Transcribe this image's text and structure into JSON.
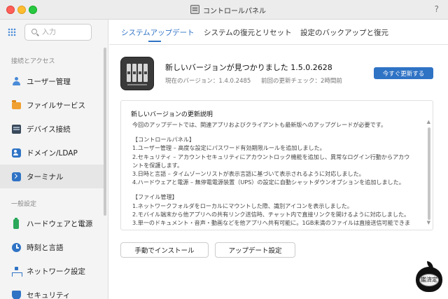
{
  "window": {
    "title": "コントロールパネル",
    "help_label": "?"
  },
  "sidebar": {
    "search_placeholder": "入力",
    "sections": [
      {
        "label": "接続とアクセス",
        "items": [
          {
            "label": "ユーザー管理",
            "icon": "user-icon"
          },
          {
            "label": "ファイルサービス",
            "icon": "folder-icon"
          },
          {
            "label": "デバイス接続",
            "icon": "device-icon"
          },
          {
            "label": "ドメイン/LDAP",
            "icon": "domain-icon"
          },
          {
            "label": "ターミナル",
            "icon": "terminal-icon",
            "active": true
          }
        ]
      },
      {
        "label": "一般設定",
        "items": [
          {
            "label": "ハードウェアと電源",
            "icon": "battery-icon"
          },
          {
            "label": "時刻と言語",
            "icon": "clock-icon"
          },
          {
            "label": "ネットワーク設定",
            "icon": "network-icon"
          },
          {
            "label": "セキュリティ",
            "icon": "shield-icon"
          }
        ]
      }
    ]
  },
  "tabs": [
    {
      "label": "システムアップデート",
      "active": true
    },
    {
      "label": "システムの復元とリセット"
    },
    {
      "label": "設定のバックアップと復元"
    }
  ],
  "update": {
    "title": "新しいバージョンが見つかりました 1.5.0.2628",
    "current_version": "現在のバージョン：1.4.0.2485",
    "last_check": "前回の更新チェック：2時間前",
    "update_now_label": "今すぐ更新する"
  },
  "notes": {
    "title": "新しいバージョンの更新説明",
    "lines": [
      "今回のアップデートでは、関連アプリおよびクライアントも最新版へのアップグレードが必要です。",
      "",
      "【コントロールパネル】",
      "1.ユーザー管理 – 高度な設定にパスワード有効期限ルールを追加しました。",
      "2.セキュリティ – アカウントセキュリティにアカウントロック機能を追加し、異常なログイン行動からアカウ",
      "ントを保護します。",
      "3.日時と言語 – タイムゾーンリストが表示言語に基づいて表示されるように対応しました。",
      "4.ハードウェアと電源 – 無停電電源装置（UPS）の設定に自動シャットダウンオプションを追加しました。",
      "",
      "【ファイル管理】",
      "1.ネットワークフォルダをローカルにマウントした際、識別アイコンを表示しました。",
      "2.モバイル端末から他アプリへの共有リンク送信時、チャット内で直接リンクを開けるように対応しました。",
      "3.単一のドキュメント・音声・動画などを他アプリへ共有可能に。1GB未満のファイルは直接送信可能できま"
    ]
  },
  "actions": {
    "manual_install_label": "手動でインストール",
    "update_settings_label": "アップデート設定"
  },
  "watermark": {
    "stamp_text": "鑑済定"
  },
  "colors": {
    "accent": "#2f73c5",
    "sidebar_bg": "#f4f4f4",
    "titlebar_bg": "#ececec"
  }
}
